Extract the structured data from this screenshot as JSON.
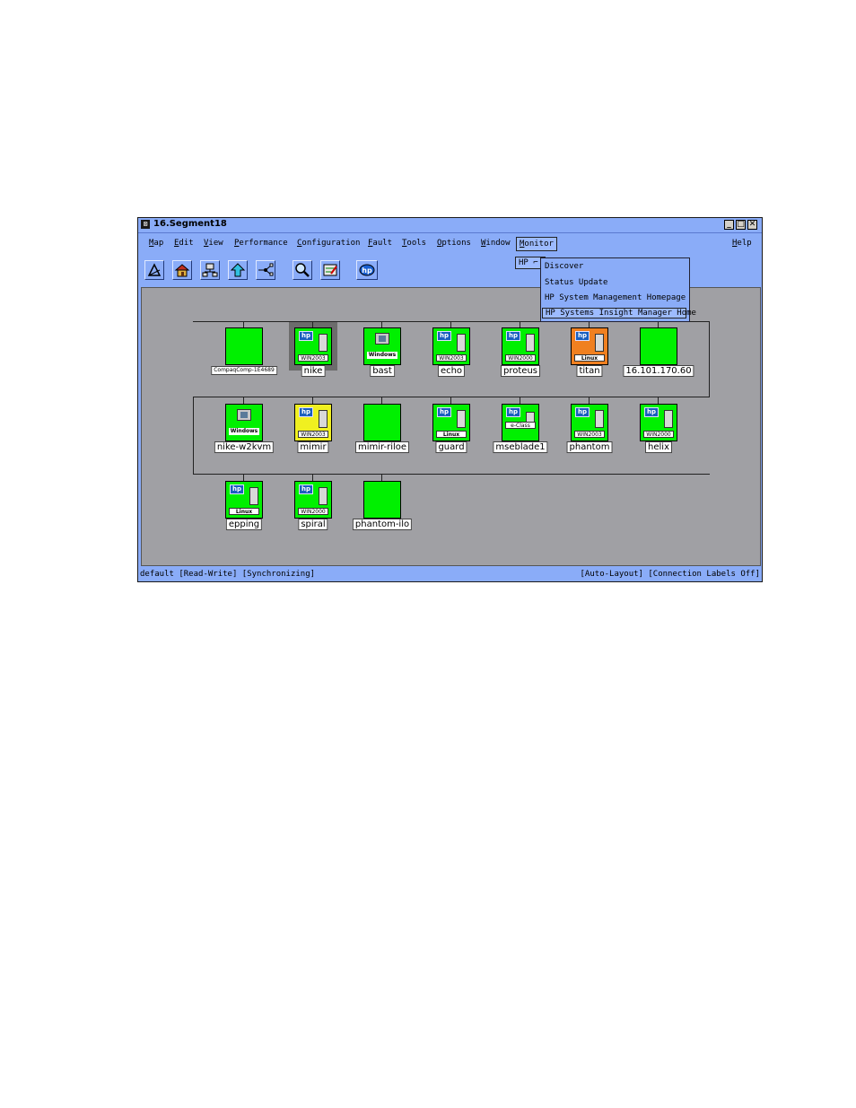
{
  "window": {
    "title": "16.Segment18"
  },
  "menubar": [
    "Map",
    "Edit",
    "View",
    "Performance",
    "Configuration",
    "Fault",
    "Tools",
    "Options",
    "Window",
    "Monitor",
    "Help"
  ],
  "monitor_menu": {
    "cascade": "HP",
    "items": [
      "Discover",
      "Status Update",
      "HP System Management Homepage",
      "HP Systems Insight Manager Home"
    ]
  },
  "toolbar": [
    "draw-icon",
    "home-icon",
    "network-icon",
    "up-arrow-icon",
    "topology-icon",
    "search-icon",
    "edit-map-icon",
    "hp-logo-icon"
  ],
  "nodes": [
    {
      "label": "CompaqComp-1E4689",
      "type": "blank",
      "color": "#00f000"
    },
    {
      "label": "nike",
      "type": "hp",
      "os": "WIN2003",
      "color": "#00f000",
      "selected": true
    },
    {
      "label": "bast",
      "type": "windows",
      "os": "Windows",
      "color": "#00f000"
    },
    {
      "label": "echo",
      "type": "hp",
      "os": "WIN2003",
      "color": "#00f000"
    },
    {
      "label": "proteus",
      "type": "hp",
      "os": "WIN2000",
      "color": "#00f000"
    },
    {
      "label": "titan",
      "type": "hp",
      "os": "Linux",
      "color": "#f08020"
    },
    {
      "label": "16.101.170.60",
      "type": "blank",
      "color": "#00f000"
    },
    {
      "label": "nike-w2kvm",
      "type": "windows",
      "os": "Windows",
      "color": "#00f000"
    },
    {
      "label": "mimir",
      "type": "hp",
      "os": "WIN2003",
      "color": "#f0f020"
    },
    {
      "label": "mimir-riloe",
      "type": "blank",
      "color": "#00f000"
    },
    {
      "label": "guard",
      "type": "hp",
      "os": "Linux",
      "color": "#00f000"
    },
    {
      "label": "mseblade1",
      "type": "eclass",
      "os": "e-Class",
      "color": "#00f000"
    },
    {
      "label": "phantom",
      "type": "hp",
      "os": "WIN2003",
      "color": "#00f000"
    },
    {
      "label": "helix",
      "type": "hp",
      "os": "WIN2000",
      "color": "#00f000"
    },
    {
      "label": "epping",
      "type": "hp",
      "os": "Linux",
      "color": "#00f000"
    },
    {
      "label": "spiral",
      "type": "hp",
      "os": "WIN2000",
      "color": "#00f000"
    },
    {
      "label": "phantom-ilo",
      "type": "blank",
      "color": "#00f000"
    }
  ],
  "status": {
    "left": "default [Read-Write] [Synchronizing]",
    "right": "[Auto-Layout] [Connection Labels Off]"
  },
  "colors": {
    "window_bg": "#8aacf8",
    "canvas_bg": "#a0a0a4",
    "status_ok": "#00f000",
    "status_major": "#f08020",
    "status_minor": "#f0f020"
  }
}
